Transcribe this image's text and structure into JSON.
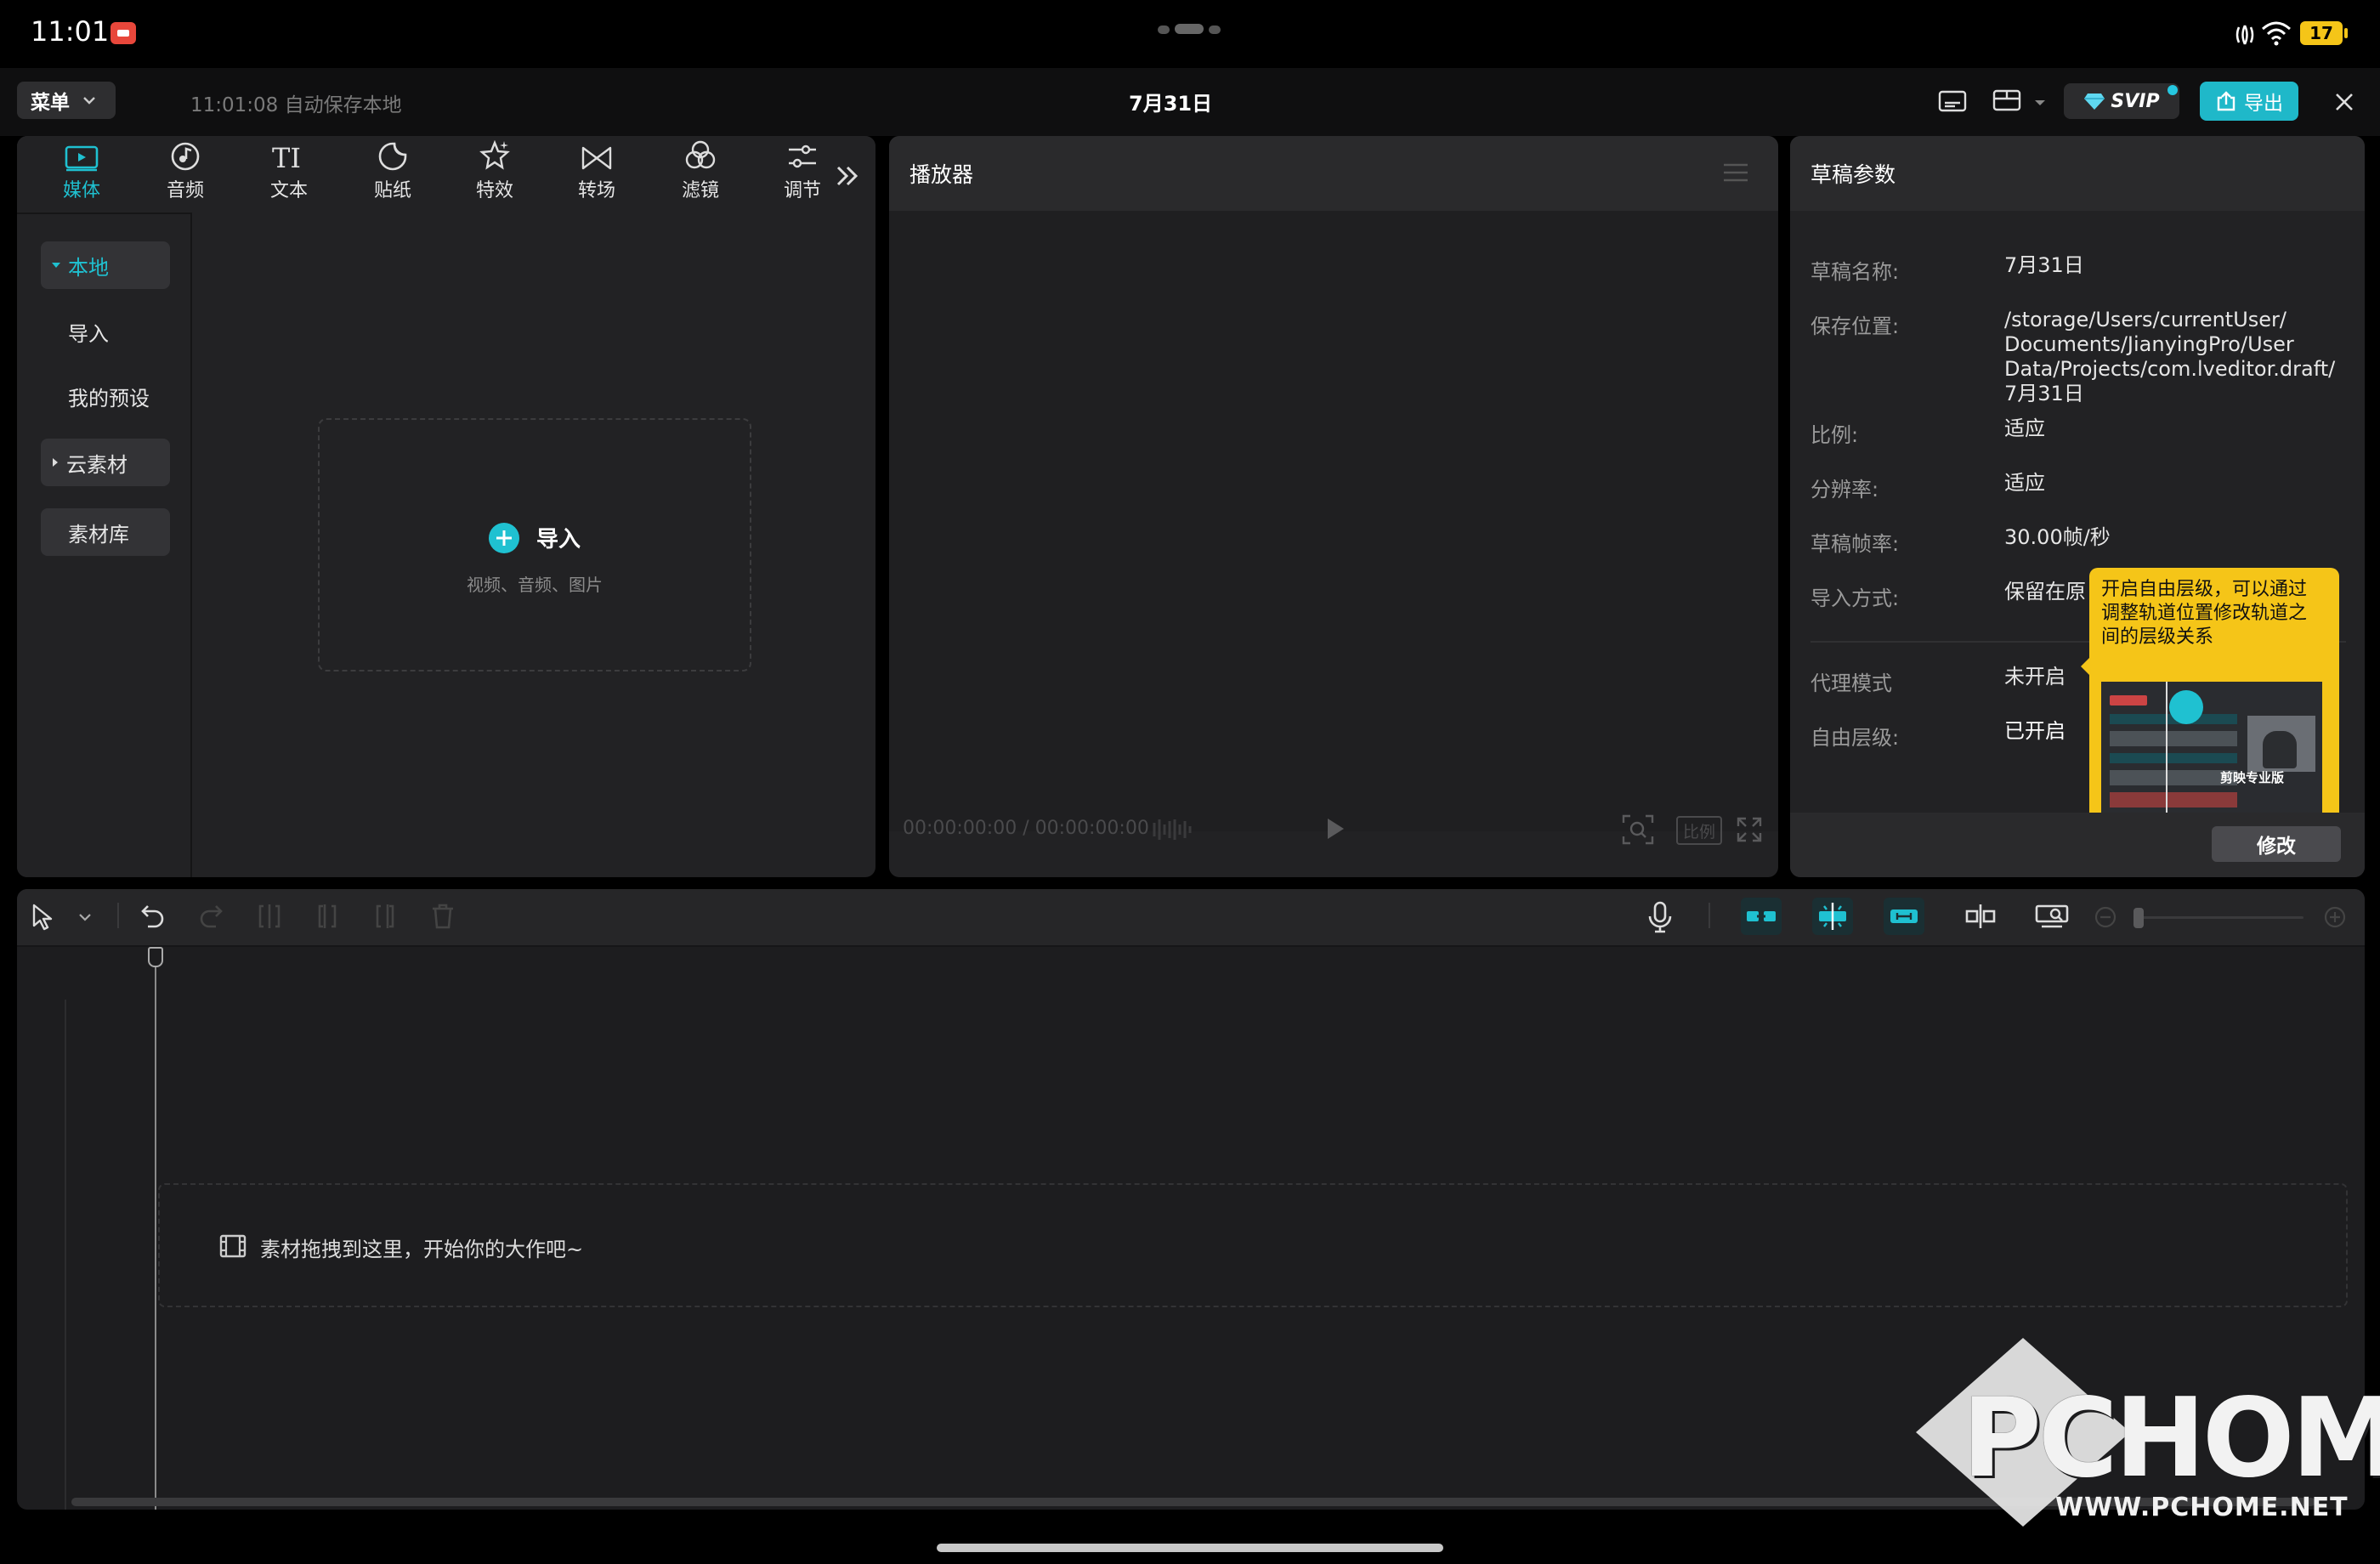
{
  "statusbar": {
    "time": "11:01",
    "battery": "17"
  },
  "topbar": {
    "menu_label": "菜单",
    "autosave_text": "11:01:08 自动保存本地",
    "project_title": "7月31日",
    "svip_label": "SVIP",
    "export_label": "导出"
  },
  "media_panel": {
    "tabs": [
      {
        "label": "媒体",
        "icon": "media-icon"
      },
      {
        "label": "音频",
        "icon": "audio-icon"
      },
      {
        "label": "文本",
        "icon": "text-icon"
      },
      {
        "label": "贴纸",
        "icon": "sticker-icon"
      },
      {
        "label": "特效",
        "icon": "effects-icon"
      },
      {
        "label": "转场",
        "icon": "transition-icon"
      },
      {
        "label": "滤镜",
        "icon": "filter-icon"
      },
      {
        "label": "调节",
        "icon": "adjust-icon"
      }
    ],
    "sidebar": {
      "local": "本地",
      "import": "导入",
      "presets": "我的预设",
      "cloud": "云素材",
      "library": "素材库"
    },
    "import_box": {
      "title": "导入",
      "subtitle": "视频、音频、图片"
    }
  },
  "player": {
    "title": "播放器",
    "timecode": "00:00:00:00 / 00:00:00:00",
    "ratio_label": "比例"
  },
  "draft_params": {
    "title": "草稿参数",
    "rows": [
      {
        "label": "草稿名称:",
        "value": "7月31日"
      },
      {
        "label": "保存位置:",
        "value_lines": [
          "/storage/Users/currentUser/",
          "Documents/JianyingPro/User",
          "Data/Projects/com.lveditor.draft/",
          "7月31日"
        ]
      },
      {
        "label": "比例:",
        "value": "适应"
      },
      {
        "label": "分辨率:",
        "value": "适应"
      },
      {
        "label": "草稿帧率:",
        "value": "30.00帧/秒"
      },
      {
        "label": "导入方式:",
        "value": "保留在原"
      },
      {
        "label": "代理模式",
        "value": "未开启"
      },
      {
        "label": "自由层级:",
        "value": "已开启"
      }
    ],
    "edit_button": "修改",
    "tooltip": {
      "lines": [
        "开启自由层级，可以通过",
        "调整轨道位置修改轨道之",
        "间的层级关系"
      ],
      "thumb_caption": "剪映专业版"
    }
  },
  "timeline": {
    "drop_hint": "素材拖拽到这里，开始你的大作吧~"
  },
  "watermark": {
    "brand": "PCHOME",
    "url": "WWW.PCHOME.NET"
  },
  "colors": {
    "accent": "#1fc1d1",
    "tooltip_bg": "#f5c518",
    "export_bg": "#1fb8c9"
  }
}
